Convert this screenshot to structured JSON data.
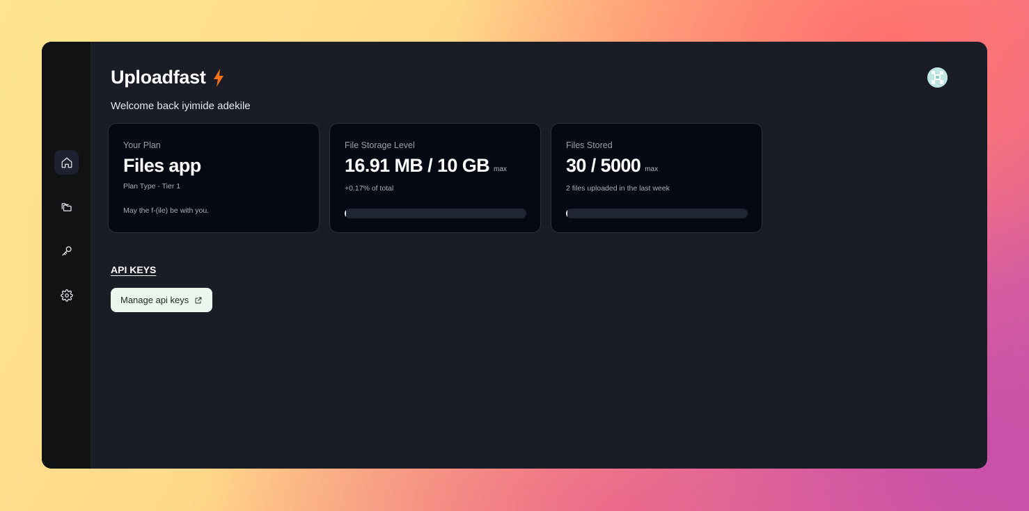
{
  "app": {
    "title": "Uploadfast",
    "welcome": "Welcome back iyimide adekile"
  },
  "sidebar": {
    "items": [
      {
        "name": "home",
        "icon": "home-icon",
        "active": true
      },
      {
        "name": "files",
        "icon": "folders-icon",
        "active": false
      },
      {
        "name": "api-keys",
        "icon": "key-icon",
        "active": false
      },
      {
        "name": "settings",
        "icon": "gear-icon",
        "active": false
      }
    ]
  },
  "cards": {
    "plan": {
      "label": "Your Plan",
      "value": "Files app",
      "sub": "Plan Type - Tier 1",
      "motto": "May the f-(ile) be with you."
    },
    "storage": {
      "label": "File Storage Level",
      "value": "16.91 MB / 10 GB",
      "max": "max",
      "sub": "+0.17% of total",
      "progress_percent": 0.17
    },
    "files": {
      "label": "Files Stored",
      "value": "30 / 5000",
      "max": "max",
      "sub": "2 files uploaded in the last week",
      "progress_percent": 0.6
    }
  },
  "api_keys": {
    "title": "API KEYS",
    "button_label": "Manage api keys"
  },
  "colors": {
    "accent_bolt": "#f97316",
    "window_bg": "#1a1d26",
    "card_bg": "#050913",
    "button_bg": "#e9f7ee"
  }
}
